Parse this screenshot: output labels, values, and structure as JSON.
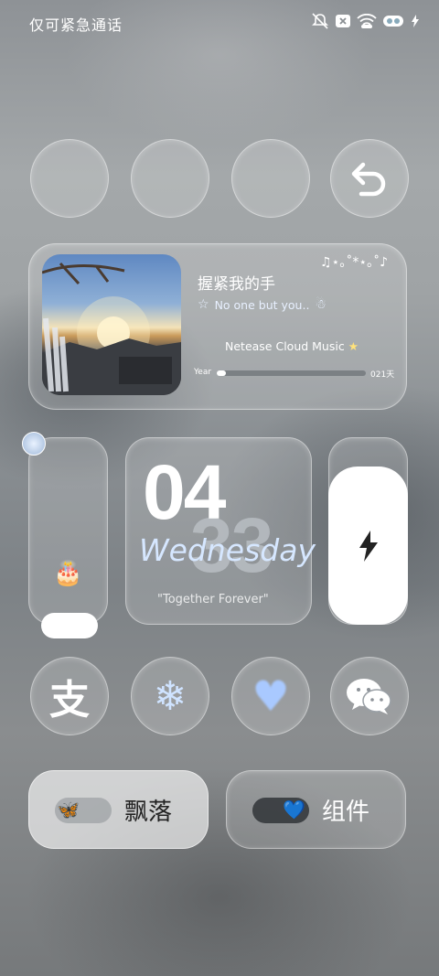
{
  "status_bar": {
    "text": "仅可紧急通话",
    "icons": [
      "mute-icon",
      "sim-none-icon",
      "wifi-icon",
      "battery-icon",
      "charging-icon"
    ]
  },
  "top_buttons": [
    {
      "name": "blank-circle-1"
    },
    {
      "name": "blank-circle-2"
    },
    {
      "name": "blank-circle-3"
    },
    {
      "name": "back-icon"
    }
  ],
  "music": {
    "title": "握紧我的手",
    "subtitle": "No one but you..",
    "app": "Netease Cloud Music",
    "year_label": "Year",
    "days_label": "021天",
    "progress": 0.06,
    "notes": "♫⋆｡˚*⋆｡˚♪"
  },
  "clock": {
    "hour": "04",
    "minute": "33",
    "weekday": "Wednesday",
    "motto": "\"Together Forever\""
  },
  "shortcuts": [
    {
      "name": "alipay-icon",
      "glyph": "支"
    },
    {
      "name": "snowflake-icon",
      "glyph": "❄"
    },
    {
      "name": "heart-icon",
      "glyph": "♥"
    },
    {
      "name": "wechat-icon",
      "glyph": ""
    }
  ],
  "toggles": {
    "left_label": "飘落",
    "right_label": "组件",
    "left_on": false,
    "right_on": true
  },
  "colors": {
    "accent_blue": "#d6e7ff",
    "heart_blue": "#a9c9ff"
  }
}
